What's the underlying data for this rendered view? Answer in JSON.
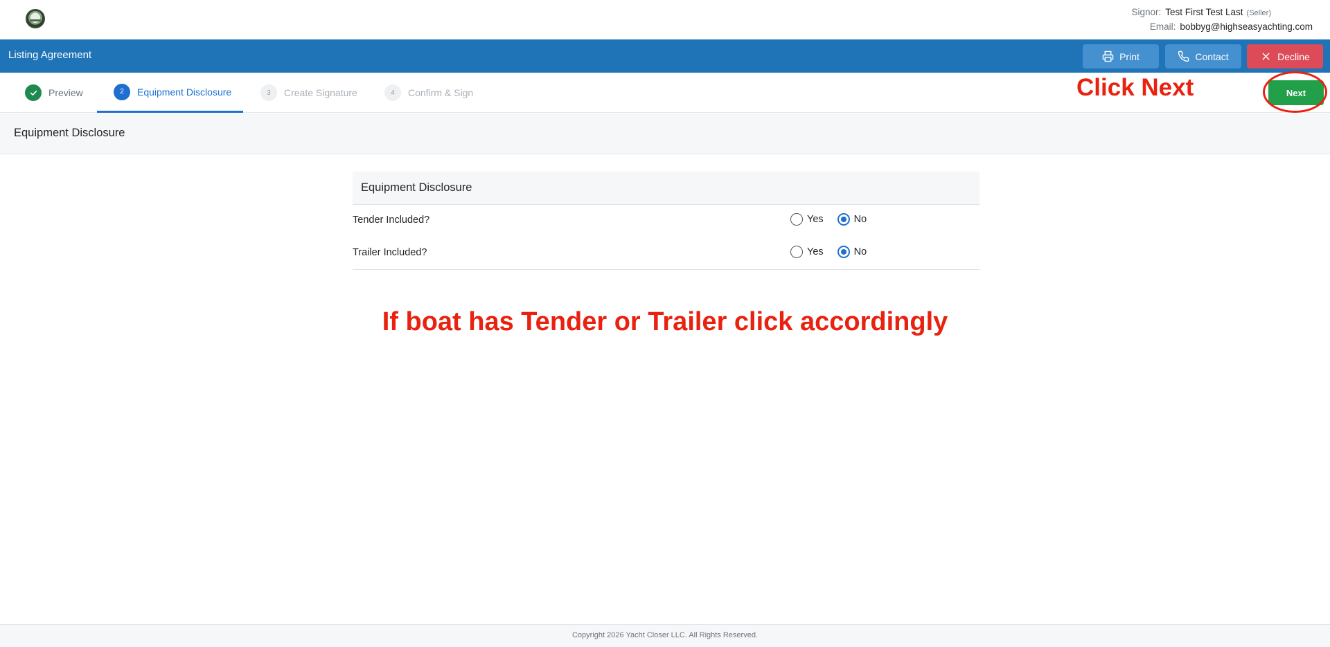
{
  "header": {
    "logo_icon": "boat-logo-icon",
    "signor_label": "Signor:",
    "signor_name": "Test First Test Last",
    "signor_role": "(Seller)",
    "email_label": "Email:",
    "email_value": "bobbyg@highseasyachting.com"
  },
  "titlebar": {
    "title": "Listing Agreement",
    "print_label": "Print",
    "contact_label": "Contact",
    "decline_label": "Decline",
    "primary_color": "#1f73b7",
    "decline_color": "#dd4b59"
  },
  "steps": [
    {
      "number": "",
      "label": "Preview",
      "state": "complete",
      "icon": "check-icon"
    },
    {
      "number": "2",
      "label": "Equipment Disclosure",
      "state": "active"
    },
    {
      "number": "3",
      "label": "Create Signature",
      "state": "disabled"
    },
    {
      "number": "4",
      "label": "Confirm & Sign",
      "state": "disabled"
    }
  ],
  "next_label": "Next",
  "annotations": {
    "click_next": "Click Next",
    "instruction": "If boat has Tender or Trailer click accordingly"
  },
  "section_title": "Equipment Disclosure",
  "card": {
    "title": "Equipment Disclosure",
    "questions": [
      {
        "label": "Tender Included?",
        "yes_label": "Yes",
        "no_label": "No",
        "selected": "No"
      },
      {
        "label": "Trailer Included?",
        "yes_label": "Yes",
        "no_label": "No",
        "selected": "No"
      }
    ]
  },
  "footer": {
    "copyright": "Copyright 2026 Yacht Closer LLC. All Rights Reserved."
  }
}
